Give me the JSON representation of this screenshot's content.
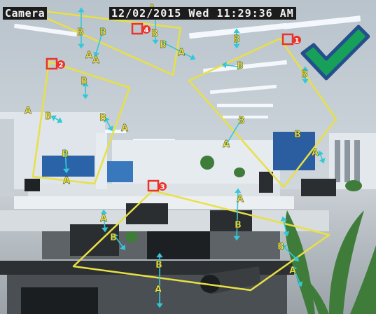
{
  "osd": {
    "camera_name": "Camera",
    "datetime": "12/02/2015 Wed 11:29:36 AM"
  },
  "markers": {
    "rule_labels": [
      "4",
      "2",
      "1",
      "3"
    ],
    "side_label_b": "B",
    "side_label_a": "A"
  },
  "colors": {
    "zone_line": "#e8e044",
    "direction_arrow": "#33c8d8",
    "rule_marker": "#e8342c",
    "check_fill": "#16a05a",
    "check_outline": "#244f8c",
    "osd_background": "#1c1c1c",
    "osd_text": "#f2f2f2"
  },
  "icons": {
    "confirm": "checkmark-icon",
    "rule_marker": "rule-number-icon"
  }
}
